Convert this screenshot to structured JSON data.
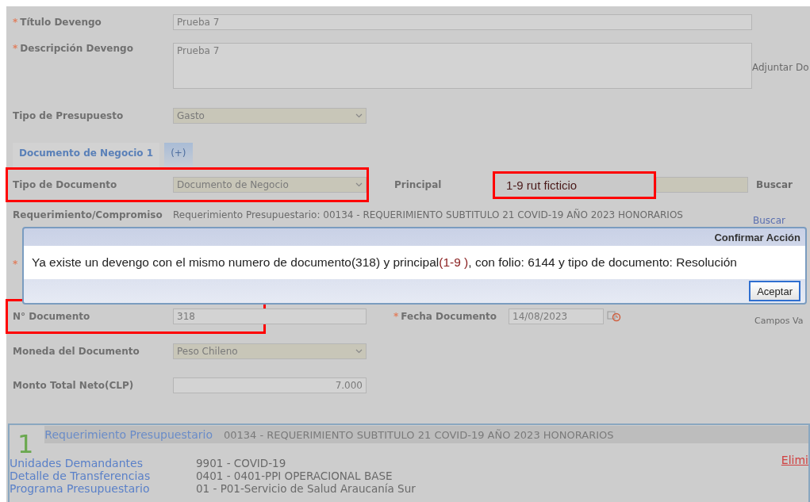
{
  "form": {
    "titulo": {
      "label": "Título Devengo",
      "required_mark": "*",
      "value": "Prueba 7"
    },
    "descripcion": {
      "label": "Descripción Devengo",
      "required_mark": "*",
      "value": "Prueba 7",
      "side_text": "Adjuntar Do"
    },
    "presupuesto": {
      "label": "Tipo de Presupuesto",
      "value": "Gasto"
    }
  },
  "tabs": [
    {
      "label": "Documento de Negocio 1",
      "selected": true
    },
    {
      "label": "(+)",
      "selected": false
    }
  ],
  "document": {
    "tipo_documento": {
      "label": "Tipo de Documento",
      "value": "Documento de Negocio",
      "highlighted": true
    },
    "principal": {
      "label": "Principal",
      "note": "1-9 rut ficticio",
      "button": "Buscar"
    },
    "requerimiento": {
      "label": "Requerimiento/Compromiso",
      "value": "Requerimiento Presupuestario: 00134 - REQUERIMIENTO SUBTITULO 21 COVID-19 AÑO 2023 HONORARIOS",
      "link": "Buscar"
    },
    "covered_row": {
      "required_mark": "*"
    },
    "numero": {
      "label": "N° Documento",
      "value": "318",
      "highlighted": true
    },
    "fecha": {
      "label": "Fecha Documento",
      "required_mark": "*",
      "value": "14/08/2023"
    },
    "side_text": "Campos Va",
    "moneda": {
      "label": "Moneda del Documento",
      "value": "Peso Chileno"
    },
    "monto": {
      "label": "Monto Total Neto(CLP)",
      "value": "7.000"
    }
  },
  "dialog": {
    "title": "Confirmar Acción",
    "message": {
      "before": "Ya existe un devengo con el mismo numero de documento(318) y principal ",
      "highlight": "(1-9 )",
      "after": ", con folio: 6144 y tipo de documento: Resolución"
    },
    "button": "Aceptar"
  },
  "budget": {
    "number": "1",
    "title": "Requerimiento Presupuestario",
    "description": "00134 - REQUERIMIENTO SUBTITULO 21 COVID-19 AÑO 2023 HONORARIOS",
    "delete_link": "Elimi",
    "details": [
      {
        "label": "Unidades Demandantes",
        "value": "9901 - COVID-19"
      },
      {
        "label": "Detalle de Transferencias",
        "value": "0401 - 0401-PPI OPERACIONAL BASE"
      },
      {
        "label": "Programa Presupuestario",
        "value": "01 - P01-Servicio de Salud Araucanía Sur"
      }
    ]
  }
}
